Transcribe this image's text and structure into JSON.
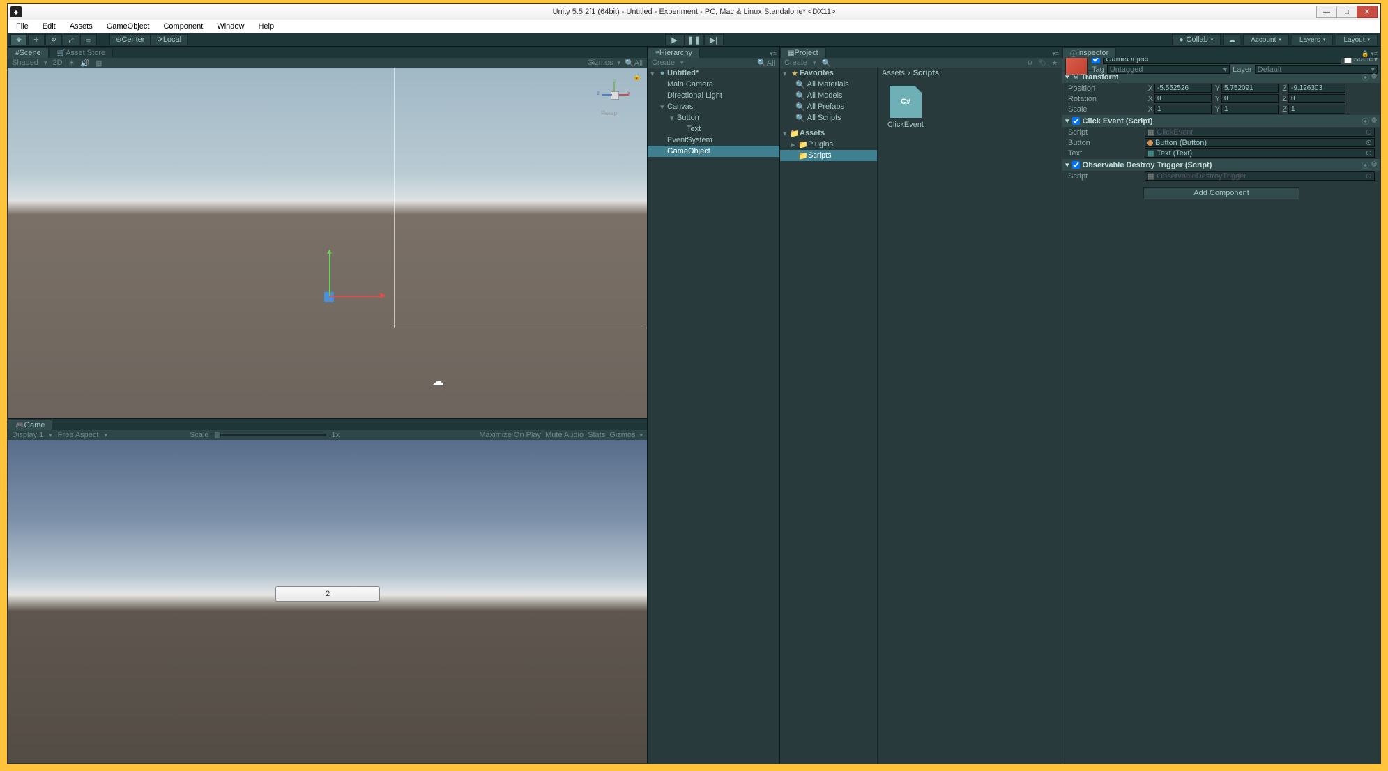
{
  "window": {
    "title": "Unity 5.5.2f1 (64bit) - Untitled - Experiment - PC, Mac & Linux Standalone* <DX11>",
    "minimize": "—",
    "maximize": "□",
    "close": "✕"
  },
  "menu": [
    "File",
    "Edit",
    "Assets",
    "GameObject",
    "Component",
    "Window",
    "Help"
  ],
  "toolbar": {
    "center": "Center",
    "local": "Local",
    "collab": "Collab",
    "account": "Account",
    "layers": "Layers",
    "layout": "Layout"
  },
  "scene": {
    "tab_scene": "Scene",
    "tab_asset_store": "Asset Store",
    "shaded": "Shaded",
    "two_d": "2D",
    "gizmos": "Gizmos",
    "search_placeholder": "All",
    "persp": "Persp",
    "axis_x": "x",
    "axis_y": "y",
    "axis_z": "z"
  },
  "game": {
    "tab": "Game",
    "display": "Display 1",
    "aspect": "Free Aspect",
    "scale": "Scale",
    "scale_val": "1x",
    "maximize": "Maximize On Play",
    "mute": "Mute Audio",
    "stats": "Stats",
    "gizmos": "Gizmos",
    "button_text": "2"
  },
  "hierarchy": {
    "tab": "Hierarchy",
    "create": "Create",
    "search_placeholder": "All",
    "items": [
      {
        "label": "Untitled*",
        "depth": 0,
        "arrow": "▾",
        "icon": "●",
        "bold": true
      },
      {
        "label": "Main Camera",
        "depth": 1
      },
      {
        "label": "Directional Light",
        "depth": 1
      },
      {
        "label": "Canvas",
        "depth": 1,
        "arrow": "▾"
      },
      {
        "label": "Button",
        "depth": 2,
        "arrow": "▾"
      },
      {
        "label": "Text",
        "depth": 3
      },
      {
        "label": "EventSystem",
        "depth": 1
      },
      {
        "label": "GameObject",
        "depth": 1,
        "selected": true
      }
    ]
  },
  "project": {
    "tab": "Project",
    "create": "Create",
    "favorites_label": "Favorites",
    "favorites": [
      "All Materials",
      "All Models",
      "All Prefabs",
      "All Scripts"
    ],
    "assets_label": "Assets",
    "assets_children": [
      {
        "label": "Plugins",
        "arrow": "▸"
      },
      {
        "label": "Scripts",
        "selected": true
      }
    ],
    "breadcrumb": [
      "Assets",
      "Scripts"
    ],
    "asset_name": "ClickEvent",
    "asset_badge": "C#"
  },
  "inspector": {
    "tab": "Inspector",
    "gameobject_name": "GameObject",
    "static": "Static",
    "tag_label": "Tag",
    "tag_value": "Untagged",
    "layer_label": "Layer",
    "layer_value": "Default",
    "transform": {
      "title": "Transform",
      "position_label": "Position",
      "rotation_label": "Rotation",
      "scale_label": "Scale",
      "pos": {
        "x": "-5.552526",
        "y": "5.752091",
        "z": "-9.126303"
      },
      "rot": {
        "x": "0",
        "y": "0",
        "z": "0"
      },
      "scl": {
        "x": "1",
        "y": "1",
        "z": "1"
      }
    },
    "click_event": {
      "title": "Click Event (Script)",
      "script_label": "Script",
      "script_value": "ClickEvent",
      "button_label": "Button",
      "button_value": "Button (Button)",
      "text_label": "Text",
      "text_value": "Text (Text)"
    },
    "destroy_trigger": {
      "title": "Observable Destroy Trigger (Script)",
      "script_label": "Script",
      "script_value": "ObservableDestroyTrigger"
    },
    "add_component": "Add Component"
  }
}
